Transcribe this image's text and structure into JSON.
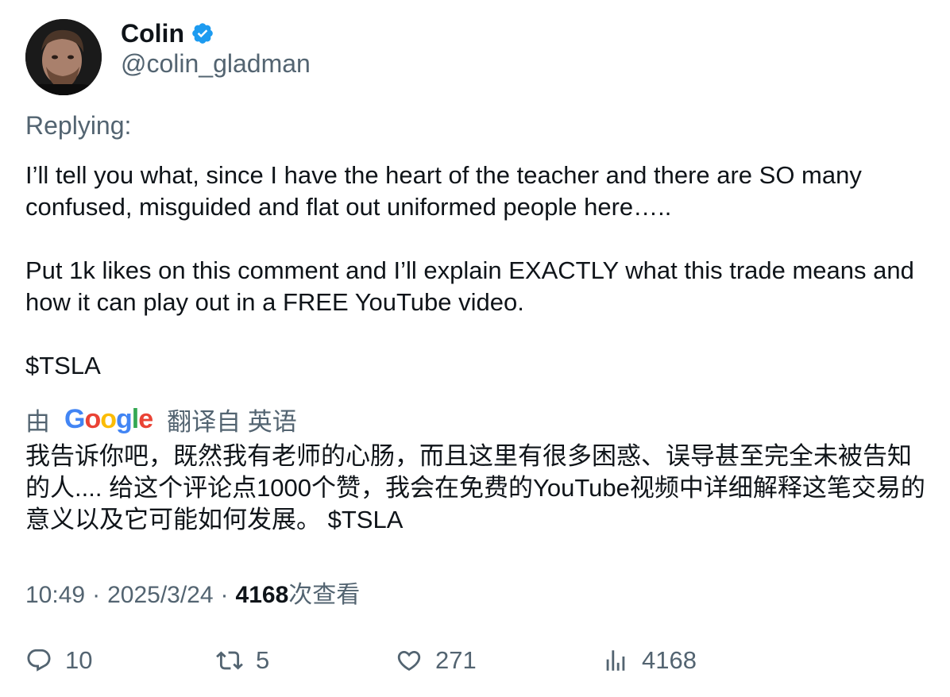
{
  "author": {
    "name": "Colin",
    "handle": "@colin_gladman",
    "verified_color": "#1d9bf0"
  },
  "tweet": {
    "replying_label": "Replying:",
    "paragraphs": [
      "I’ll tell you what, since I have the heart of the teacher and there are SO many confused, misguided and flat out uniformed people here…..",
      "Put 1k likes on this comment and I’ll explain EXACTLY what this trade means and how it can play out in a FREE YouTube video.",
      "$TSLA"
    ]
  },
  "translation": {
    "prefix": "由",
    "provider": "Google",
    "suffix": "翻译自 英语",
    "text": "我告诉你吧，既然我有老师的心肠，而且这里有很多困惑、误导甚至完全未被告知的人.... 给这个评论点1000个赞，我会在免费的YouTube视频中详细解释这笔交易的意义以及它可能如何发展。 $TSLA"
  },
  "meta": {
    "time": "10:49",
    "date": "2025/3/24",
    "separator": "·",
    "views_count": "4168",
    "views_label": "次查看"
  },
  "actions": {
    "replies": "10",
    "retweets": "5",
    "likes": "271",
    "views": "4168",
    "icon_names": [
      "reply-icon",
      "retweet-icon",
      "like-icon",
      "views-icon"
    ]
  }
}
